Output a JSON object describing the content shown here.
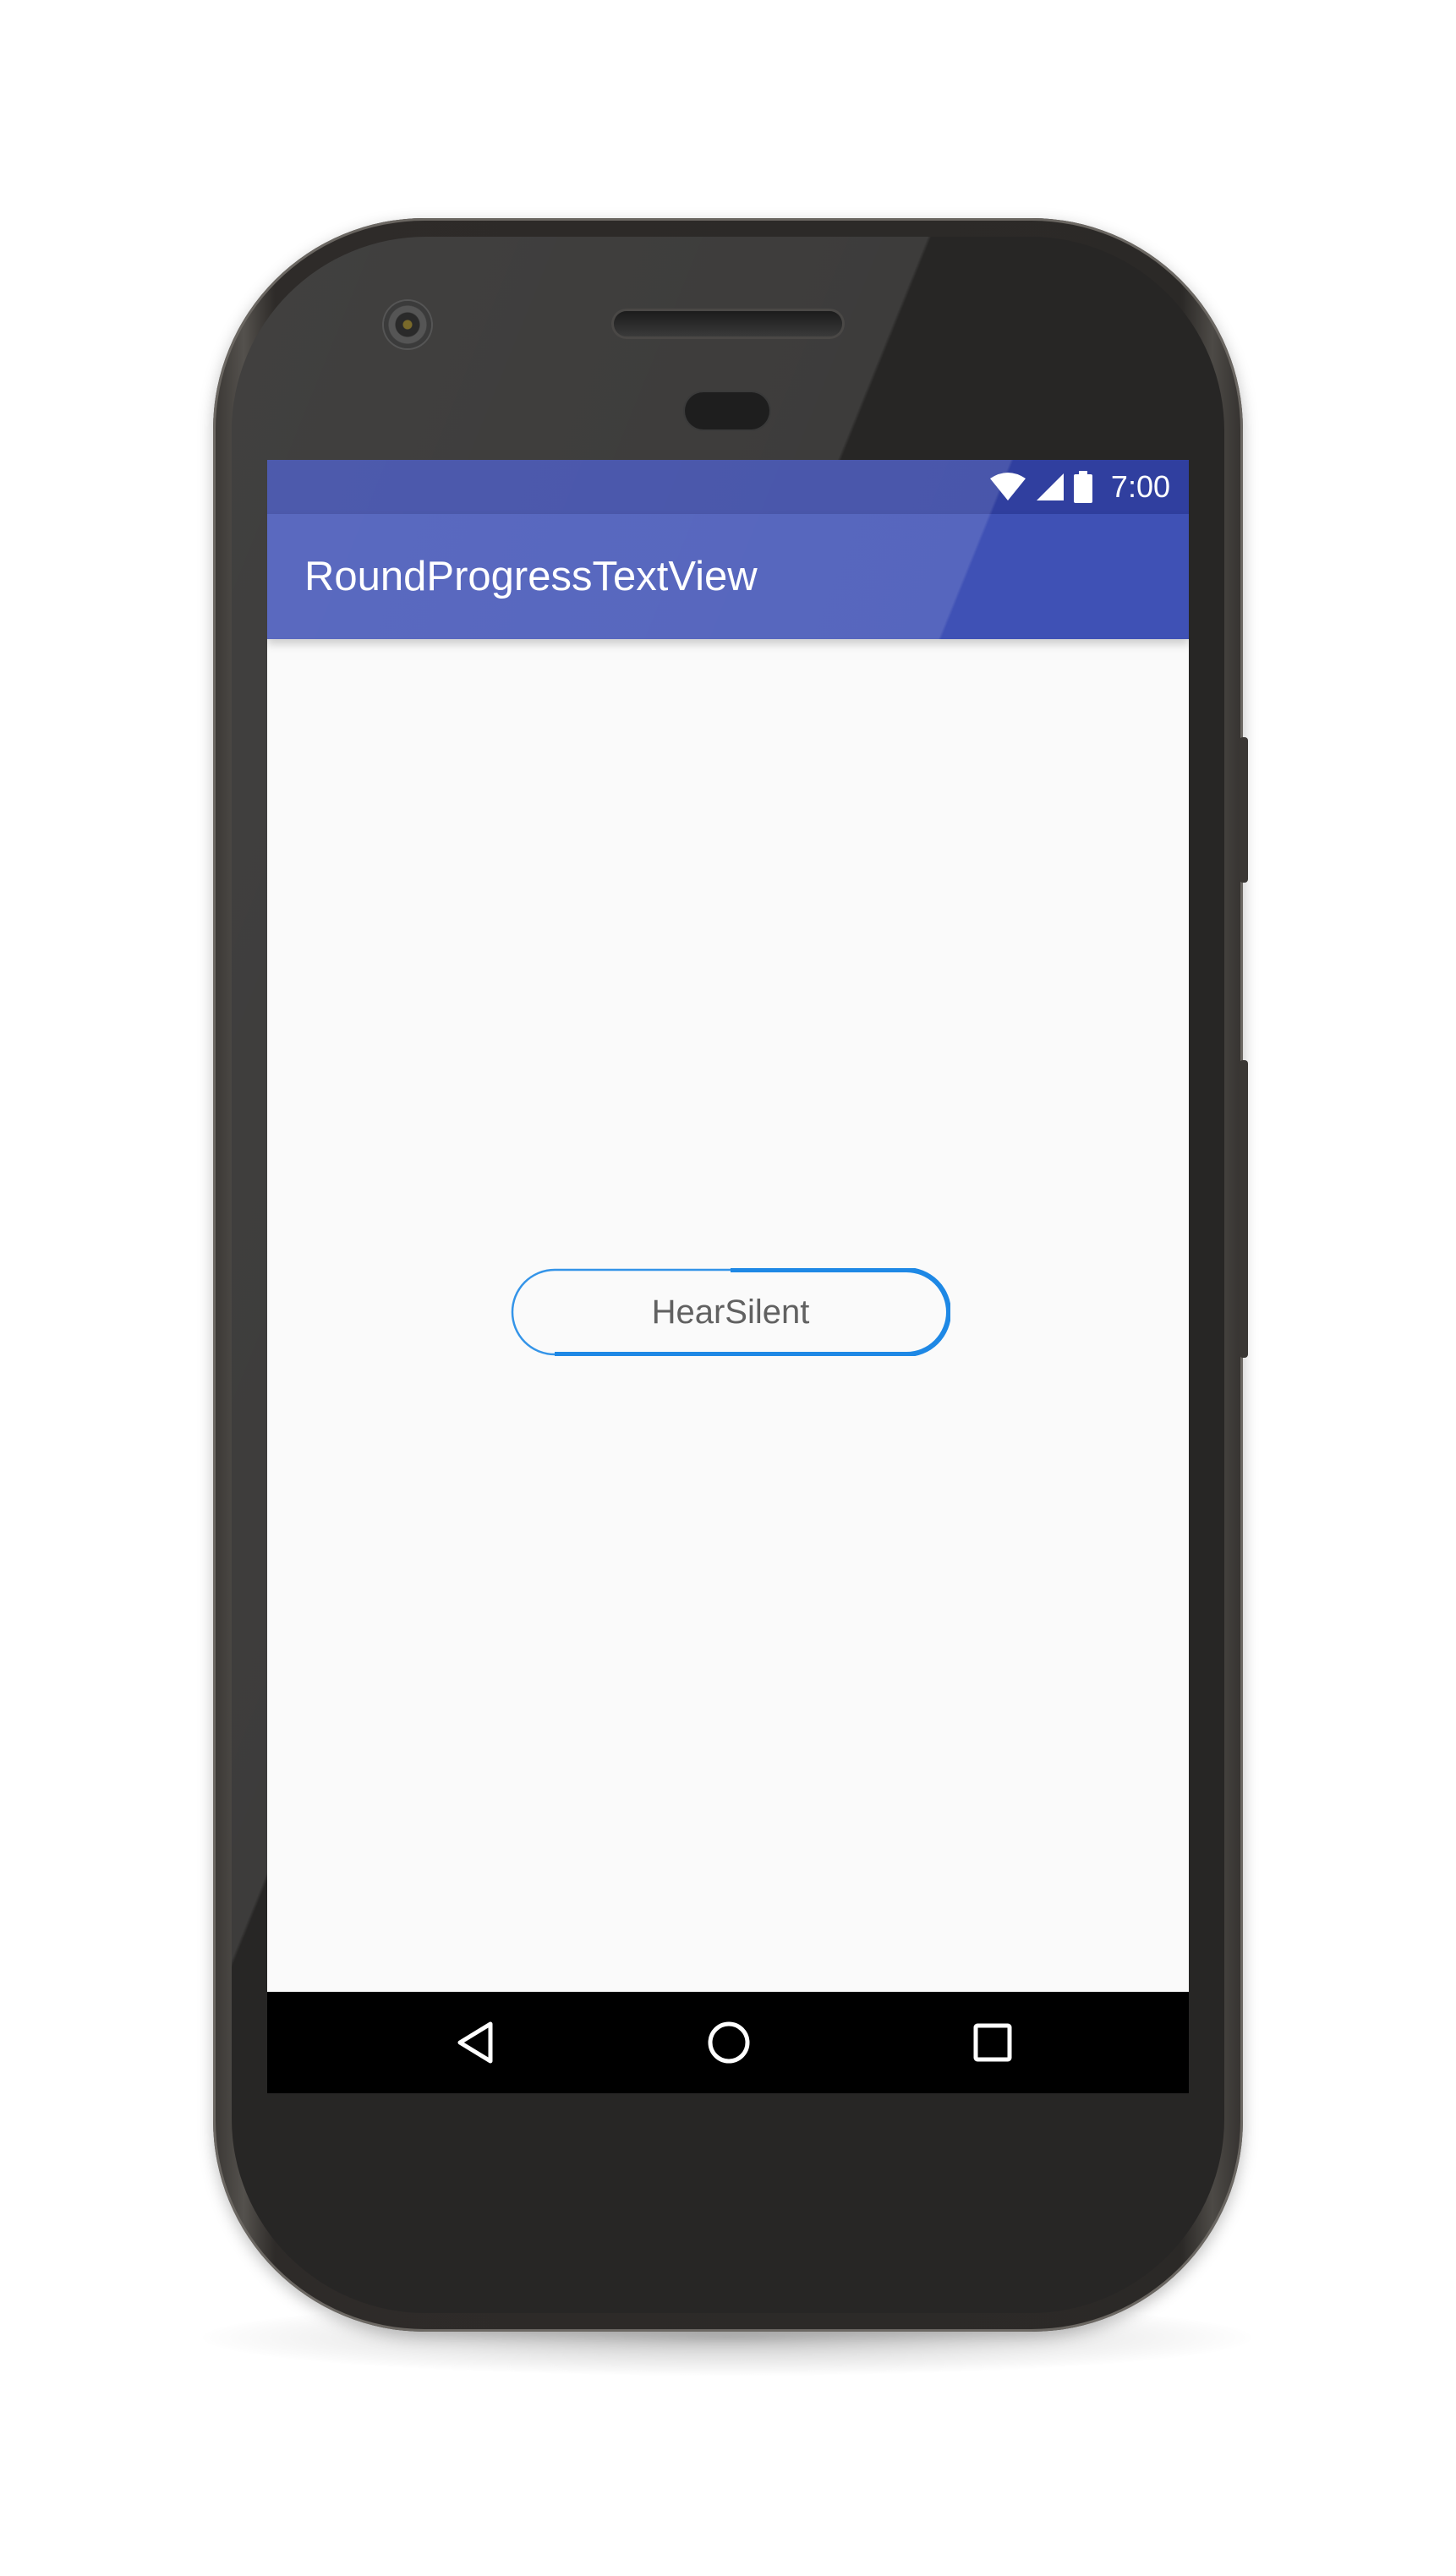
{
  "status_bar": {
    "time": "7:00",
    "icons": [
      "wifi-icon",
      "cellular-signal-icon",
      "battery-icon"
    ]
  },
  "app_bar": {
    "title": "RoundProgressTextView"
  },
  "progress_text_view": {
    "label": "HearSilent",
    "progress": 0.5,
    "track_color": "#1e88e5"
  },
  "nav_bar": {
    "buttons": [
      "back-icon",
      "home-icon",
      "recents-icon"
    ]
  },
  "colors": {
    "status_bar": "#303f9f",
    "app_bar": "#3f51b5",
    "background": "#fafafa",
    "accent": "#1e88e5"
  }
}
